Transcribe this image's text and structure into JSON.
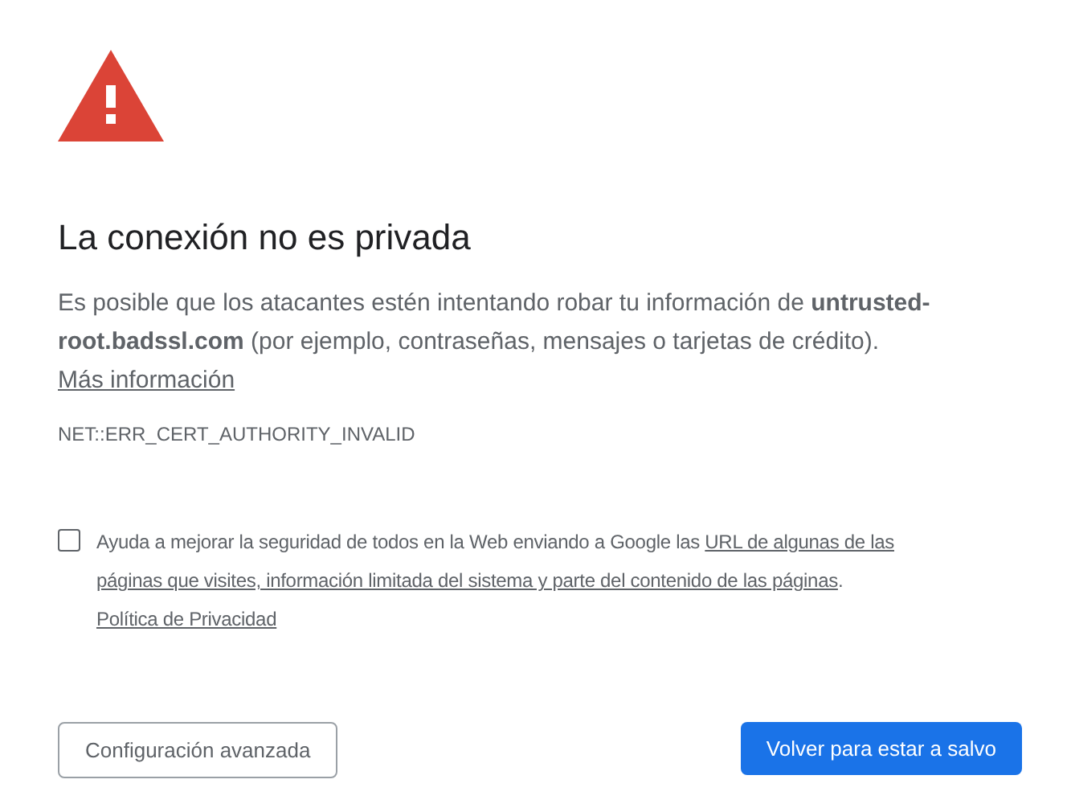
{
  "title": "La conexión no es privada",
  "description": [
    {
      "kind": "text",
      "text": "Es posible que los atacantes estén intentando robar tu información de **untrusted-root.badssl.com** (por ejemplo, contraseñas, mensajes o tarjetas de crédito). "
    },
    {
      "kind": "link",
      "text": "Más información"
    }
  ],
  "error_code": "NET::ERR_CERT_AUTHORITY_INVALID",
  "report_option": {
    "checked": false,
    "label": [
      {
        "kind": "text",
        "text": "Ayuda a mejorar la seguridad de todos en la Web enviando a Google las "
      },
      {
        "kind": "link",
        "text": "URL de algunas de las"
      },
      {
        "kind": "link",
        "text": "páginas que visites, información limitada del sistema y parte del contenido de las páginas"
      },
      {
        "kind": "text",
        "text": ". "
      },
      {
        "kind": "link",
        "text": "Política de Privacidad"
      }
    ]
  },
  "buttons": [
    {
      "kind": "secondary",
      "label": "Configuración avanzada"
    },
    {
      "kind": "primary",
      "label": "Volver para estar a salvo"
    }
  ]
}
